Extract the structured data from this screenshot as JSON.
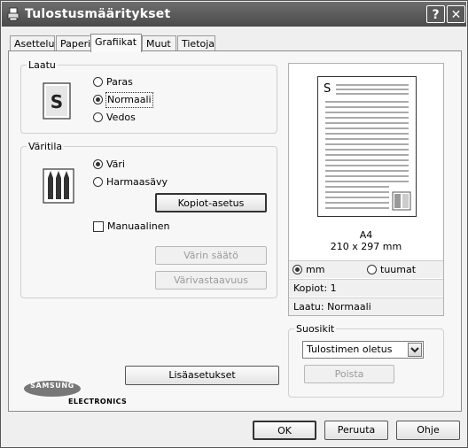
{
  "window": {
    "title": "Tulostusmääritykset",
    "help_label": "?",
    "close_label": "✕"
  },
  "tabs": [
    {
      "label": "Asettelu"
    },
    {
      "label": "Paperi"
    },
    {
      "label": "Grafiikat"
    },
    {
      "label": "Muut"
    },
    {
      "label": "Tietoja"
    }
  ],
  "quality": {
    "legend": "Laatu",
    "icon": "document-s-icon",
    "options": [
      "Paras",
      "Normaali",
      "Vedos"
    ],
    "selected": "Normaali"
  },
  "color_mode": {
    "legend": "Väritila",
    "icon": "pencils-icon",
    "options": [
      "Väri",
      "Harmaasävy"
    ],
    "selected": "Väri",
    "copies_button": "Kopiot-asetus",
    "manual_label": "Manuaalinen",
    "manual_checked": false,
    "color_adjust_button": "Värin säätö",
    "color_match_button": "Värivastaavuus"
  },
  "advanced_button": "Lisäasetukset",
  "brand": {
    "name": "SAMSUNG",
    "sub": "ELECTRONICS"
  },
  "preview": {
    "paper_letter": "S",
    "paper_name": "A4",
    "paper_size": "210 x 297 mm",
    "unit_mm": "mm",
    "unit_inch": "tuumat",
    "unit_selected": "mm",
    "copies": "Kopiot: 1",
    "quality": "Laatu: Normaali"
  },
  "favorites": {
    "legend": "Suosikit",
    "selected": "Tulostimen oletus",
    "delete_button": "Poista"
  },
  "footer": {
    "ok": "OK",
    "cancel": "Peruuta",
    "help": "Ohje"
  }
}
